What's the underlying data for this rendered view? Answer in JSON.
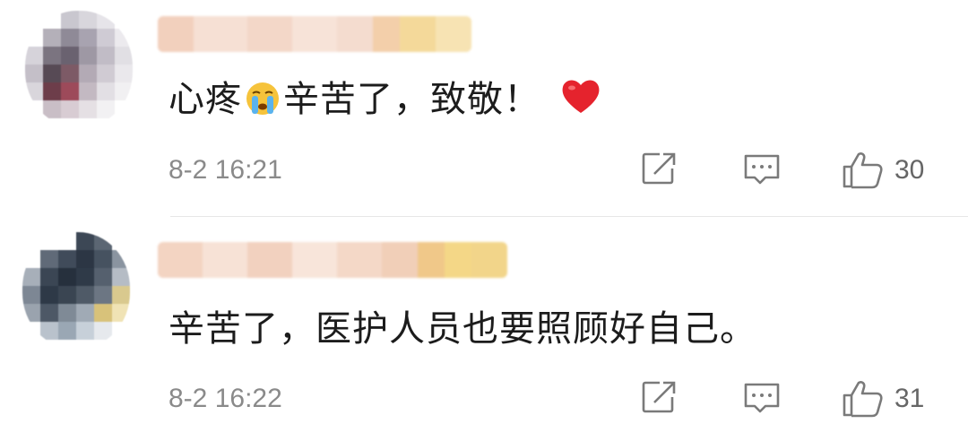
{
  "comments": [
    {
      "username": "",
      "text_before": "心疼",
      "emoji": "crying-face-icon",
      "text_after": "辛苦了，致敬！",
      "trailing_emoji": "red-heart-icon",
      "time": "8-2 16:21",
      "likes": "30"
    },
    {
      "username": "",
      "text": "辛苦了，医护人员也要照顾好自己。",
      "time": "8-2 16:22",
      "likes": "31"
    }
  ],
  "icons": {
    "share": "share-icon",
    "comment": "comment-icon",
    "like": "thumbs-up-icon"
  },
  "colors": {
    "icon_gray": "#7a7a7a",
    "time_gray": "#8a8a8a",
    "heart_red": "#e5232d",
    "divider": "#e6e6e6"
  }
}
